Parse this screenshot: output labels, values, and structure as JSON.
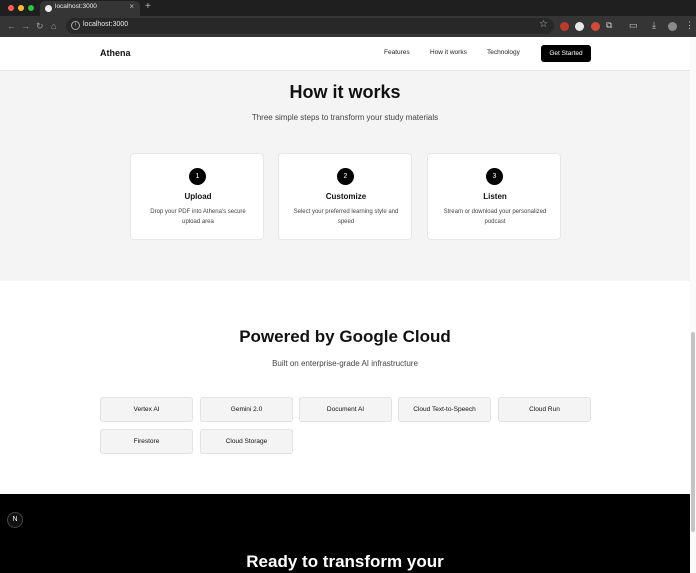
{
  "browser": {
    "tab_title": "localhost:3000",
    "url": "localhost:3000"
  },
  "site": {
    "brand": "Athena",
    "nav": [
      "Features",
      "How it works",
      "Technology"
    ],
    "cta": "Get Started"
  },
  "how_it_works": {
    "title": "How it works",
    "subtitle": "Three simple steps to transform your study materials",
    "steps": [
      {
        "num": "1",
        "title": "Upload",
        "desc": "Drop your PDF into Athena's secure upload area"
      },
      {
        "num": "2",
        "title": "Customize",
        "desc": "Select your preferred learning style and speed"
      },
      {
        "num": "3",
        "title": "Listen",
        "desc": "Stream or download your personalized podcast"
      }
    ]
  },
  "tech": {
    "title": "Powered by Google Cloud",
    "subtitle": "Built on enterprise-grade AI infrastructure",
    "items": [
      "Vertex AI",
      "Gemini 2.0",
      "Document AI",
      "Cloud Text-to-Speech",
      "Cloud Run",
      "Firestore",
      "Cloud Storage"
    ]
  },
  "cta_section": {
    "title": "Ready to transform your"
  },
  "dev": {
    "badge": "N"
  },
  "icons": {
    "traffic_lights": [
      "#fe5f57",
      "#febc2e",
      "#28c840"
    ],
    "extensions": [
      "#c0392b",
      "#e8e8e8",
      "#d44a3a"
    ]
  }
}
